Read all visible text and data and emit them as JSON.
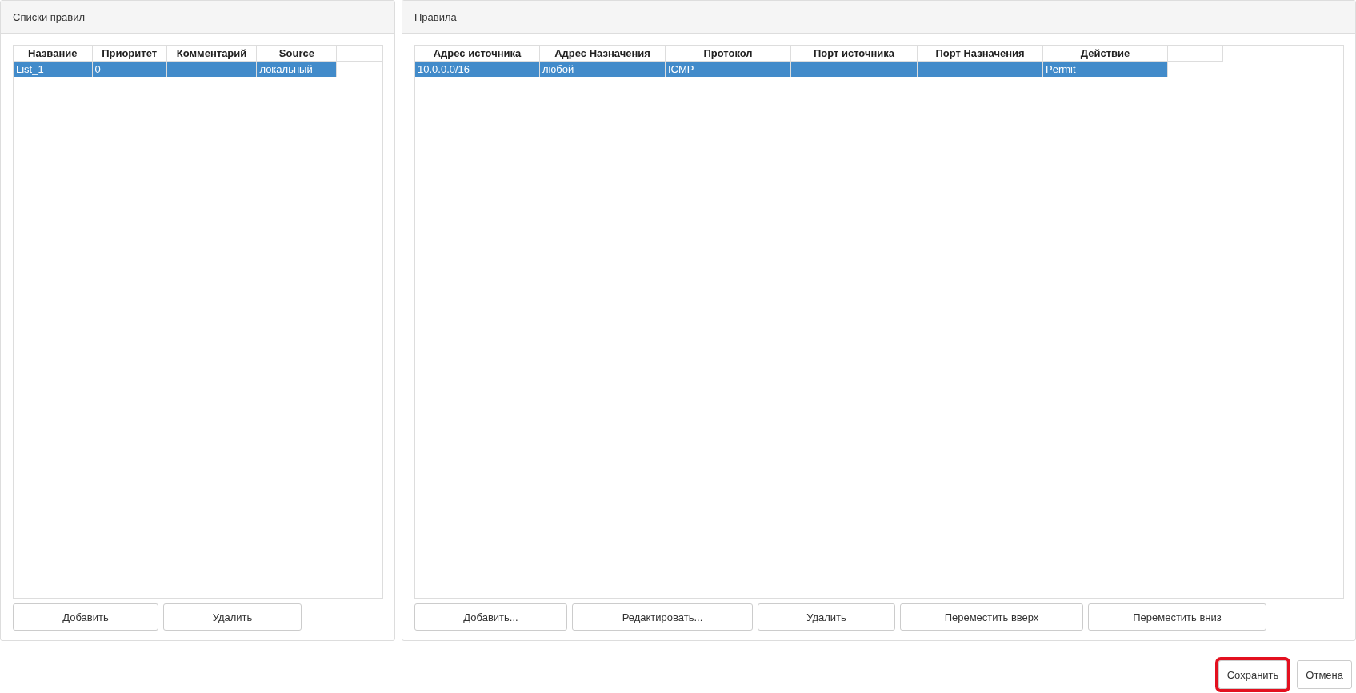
{
  "panels": [
    {
      "title": "Списки правил",
      "table": {
        "columns": [
          "Название",
          "Приоритет",
          "Комментарий",
          "Source"
        ],
        "rows": [
          {
            "cells": [
              "List_1",
              "0",
              "",
              "локальный"
            ],
            "selected": true
          }
        ]
      },
      "buttons": [
        "Добавить",
        "Удалить"
      ]
    },
    {
      "title": "Правила",
      "table": {
        "columns": [
          "Адрес источника",
          "Адрес Назначения",
          "Протокол",
          "Порт источника",
          "Порт Назначения",
          "Действие"
        ],
        "rows": [
          {
            "cells": [
              "10.0.0.0/16",
              "любой",
              "ICMP",
              "",
              "",
              "Permit"
            ],
            "selected": true
          }
        ]
      },
      "buttons": [
        "Добавить...",
        "Редактировать...",
        "Удалить",
        "Переместить вверх",
        "Переместить вниз"
      ]
    }
  ],
  "footer_buttons": [
    {
      "label": "Сохранить",
      "highlighted": true
    },
    {
      "label": "Отмена",
      "highlighted": false
    }
  ]
}
